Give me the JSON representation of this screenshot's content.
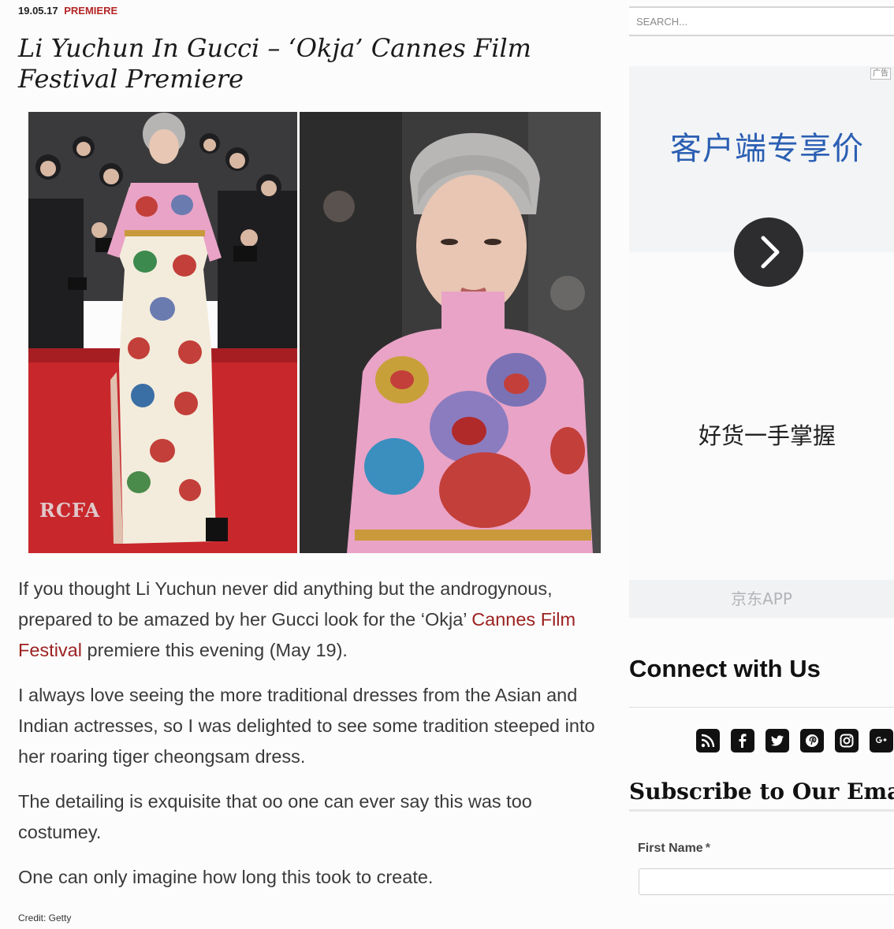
{
  "article": {
    "date": "19.05.17",
    "category": "PREMIERE",
    "title": "Li Yuchun In Gucci – ‘Okja’ Cannes Film Festival Premiere",
    "watermark": "RCFA",
    "paragraphs": {
      "p1_before": "If you thought Li Yuchun never did anything but the androgynous, prepared to be amazed by her Gucci look for the ‘Okja’ ",
      "p1_link": "Cannes Film Festival",
      "p1_after": " premiere this evening (May 19).",
      "p2": "I always love seeing the more traditional dresses from the Asian and Indian actresses, so I was delighted to see some tradition steeped into her roaring tiger cheongsam dress.",
      "p3": "The detailing is exquisite that oo one can ever say this was too costumey.",
      "p4": "One can only imagine how long this took to create."
    },
    "credit": "Credit: Getty"
  },
  "sidebar": {
    "search_placeholder": "SEARCH...",
    "ad": {
      "badge": "广告",
      "headline": "客户端专享价",
      "tagline": "好货一手掌握",
      "cta": "京东APP"
    },
    "connect_heading": "Connect with Us",
    "social_icons": [
      "rss-icon",
      "facebook-icon",
      "twitter-icon",
      "pinterest-icon",
      "instagram-icon",
      "google-plus-icon"
    ],
    "subscribe_heading": "Subscribe to Our Email",
    "form": {
      "first_name_label": "First Name",
      "required_mark": "*"
    }
  },
  "colors": {
    "category": "#b52626",
    "link": "#9c2121",
    "ad_headline": "#2b5fb3",
    "carpet_red": "#c8272c",
    "dress_pink": "#e9a3c6"
  }
}
